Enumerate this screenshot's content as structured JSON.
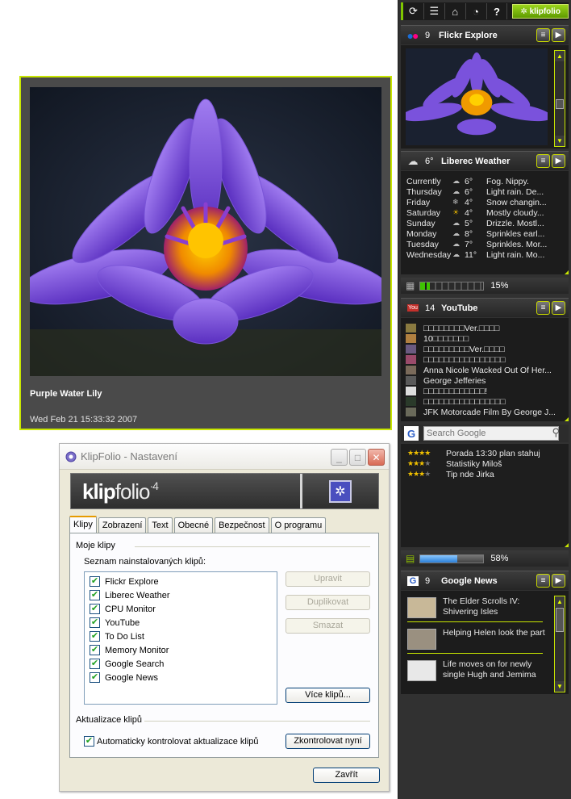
{
  "photo": {
    "title": "Purple Water Lily",
    "date": "Wed Feb 21 15:33:32 2007"
  },
  "dialog": {
    "title": "KlipFolio - Nastavení",
    "logo_main": "klip",
    "logo_light": "folio",
    "logo_version": "4",
    "tabs": [
      "Klipy",
      "Zobrazení",
      "Text",
      "Obecné",
      "Bezpečnost",
      "O programu"
    ],
    "group1_title": "Moje klipy",
    "list_label": "Seznam nainstalovaných klipů:",
    "klips": [
      "Flickr Explore",
      "Liberec Weather",
      "CPU Monitor",
      "YouTube",
      "To Do List",
      "Memory Monitor",
      "Google Search",
      "Google News"
    ],
    "btn_edit": "Upravit",
    "btn_duplicate": "Duplikovat",
    "btn_delete": "Smazat",
    "btn_more": "Více klipů...",
    "group2_title": "Aktualizace klipů",
    "auto_update_label": "Automaticky kontrolovat aktualizace klipů",
    "btn_check_now": "Zkontrolovat nyní",
    "btn_close": "Zavřít"
  },
  "sidebar": {
    "logo": "klipfolio",
    "flickr": {
      "count": "9",
      "name": "Flickr Explore"
    },
    "weather": {
      "count": "6°",
      "name": "Liberec Weather",
      "rows": [
        {
          "day": "Currently",
          "temp": "6°",
          "text": "Fog. Nippy."
        },
        {
          "day": "Thursday",
          "temp": "6°",
          "text": "Light rain. De..."
        },
        {
          "day": "Friday",
          "temp": "4°",
          "text": "Snow changin..."
        },
        {
          "day": "Saturday",
          "temp": "4°",
          "text": "Mostly cloudy..."
        },
        {
          "day": "Sunday",
          "temp": "5°",
          "text": "Drizzle. Mostl..."
        },
        {
          "day": "Monday",
          "temp": "8°",
          "text": "Sprinkles earl..."
        },
        {
          "day": "Tuesday",
          "temp": "7°",
          "text": "Sprinkles. Mor..."
        },
        {
          "day": "Wednesday",
          "temp": "11°",
          "text": "Light rain. Mo..."
        }
      ]
    },
    "cpu": {
      "pct": "15%",
      "value": 0.15
    },
    "youtube": {
      "count": "14",
      "name": "YouTube",
      "rows": [
        "□□□□□□□□Ver.□□□□",
        "10□□□□□□□",
        "□□□□□□□□□Ver.□□□□",
        "□□□□□□□□□□□□□□□□",
        "Anna Nicole Wacked Out Of Her...",
        "George Jefferies",
        "□□□□□□□□□□□□!",
        "□□□□□□□□□□□□□□□□",
        "JFK Motorcade Film By George J..."
      ]
    },
    "gsearch": {
      "placeholder": "Search Google"
    },
    "todo": [
      {
        "stars": 4,
        "text": "Porada 13:30 plan stahuj"
      },
      {
        "stars": 3,
        "text": "Statistiky Miloš"
      },
      {
        "stars": 3,
        "text": "Tip nde Jirka"
      }
    ],
    "memory": {
      "pct": "58%",
      "value": 0.58
    },
    "gnews": {
      "count": "9",
      "name": "Google News",
      "items": [
        "The Elder Scrolls IV: Shivering Isles",
        "Helping Helen look the part",
        "Life moves on for newly single Hugh and Jemima"
      ]
    }
  }
}
